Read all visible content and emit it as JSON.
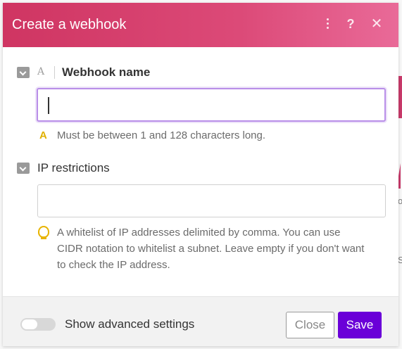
{
  "modal": {
    "title": "Create a webhook",
    "header_icons": [
      "kebab-menu-icon",
      "help-icon",
      "close-icon"
    ],
    "close_glyph": "✕",
    "help_glyph": "?"
  },
  "fields": {
    "webhook_name": {
      "label": "Webhook name",
      "type_glyph": "A",
      "value": "",
      "hint_glyph": "A",
      "hint": "Must be between 1 and 128 characters long."
    },
    "ip_restrictions": {
      "label": "IP restrictions",
      "value": "",
      "hint_line1": "A whitelist of IP addresses delimited by comma. You can use",
      "hint_line2": "CIDR notation to whitelist a subnet. Leave empty if you don't want",
      "hint_line3": "to check the IP address."
    }
  },
  "footer": {
    "advanced_toggle_label": "Show advanced settings",
    "advanced_enabled": false,
    "close_label": "Close",
    "save_label": "Save"
  },
  "background": {
    "letters": [
      "o",
      "S"
    ]
  },
  "colors": {
    "header_start": "#cf3562",
    "header_end": "#e96a98",
    "save_button": "#6a00d8",
    "focus_ring": "#b98ee8",
    "hint_icon": "#e0b000"
  }
}
